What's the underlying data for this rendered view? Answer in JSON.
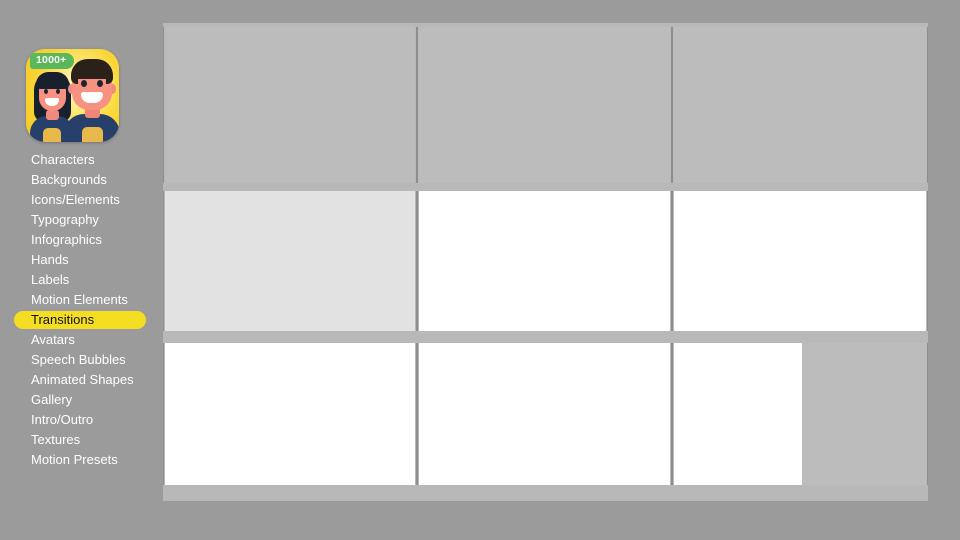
{
  "app": {
    "icon_name": "characters-app-icon",
    "badge_label": "1000+",
    "badge_color": "#5bb75b",
    "icon_bg_color": "#fbd93c"
  },
  "theme": {
    "page_background": "#9b9b9b",
    "panel_background": "#b8b8b8",
    "cell_gray": "#bcbcbc",
    "cell_light": "#e2e2e2",
    "cell_white": "#ffffff",
    "menu_text": "#ffffff",
    "active_pill": "#f5dd24",
    "active_text": "#111111"
  },
  "sidebar": {
    "items": [
      {
        "label": "Characters",
        "active": false
      },
      {
        "label": "Backgrounds",
        "active": false
      },
      {
        "label": "Icons/Elements",
        "active": false
      },
      {
        "label": "Typography",
        "active": false
      },
      {
        "label": "Infographics",
        "active": false
      },
      {
        "label": "Hands",
        "active": false
      },
      {
        "label": "Labels",
        "active": false
      },
      {
        "label": "Motion Elements",
        "active": false
      },
      {
        "label": "Transitions",
        "active": true
      },
      {
        "label": "Avatars",
        "active": false
      },
      {
        "label": "Speech Bubbles",
        "active": false
      },
      {
        "label": "Animated Shapes",
        "active": false
      },
      {
        "label": "Gallery",
        "active": false
      },
      {
        "label": "Intro/Outro",
        "active": false
      },
      {
        "label": "Textures",
        "active": false
      },
      {
        "label": "Motion Presets",
        "active": false
      }
    ]
  },
  "content": {
    "grid": {
      "rows": 3,
      "columns": 3,
      "cells": [
        {
          "row": 1,
          "column": 1,
          "fill": "gray"
        },
        {
          "row": 1,
          "column": 2,
          "fill": "gray"
        },
        {
          "row": 1,
          "column": 3,
          "fill": "gray"
        },
        {
          "row": 2,
          "column": 1,
          "fill": "light"
        },
        {
          "row": 2,
          "column": 2,
          "fill": "white"
        },
        {
          "row": 2,
          "column": 3,
          "fill": "white"
        },
        {
          "row": 3,
          "column": 1,
          "fill": "white"
        },
        {
          "row": 3,
          "column": 2,
          "fill": "white"
        },
        {
          "row": 3,
          "column": 3,
          "fill": "partial-white"
        }
      ]
    }
  }
}
